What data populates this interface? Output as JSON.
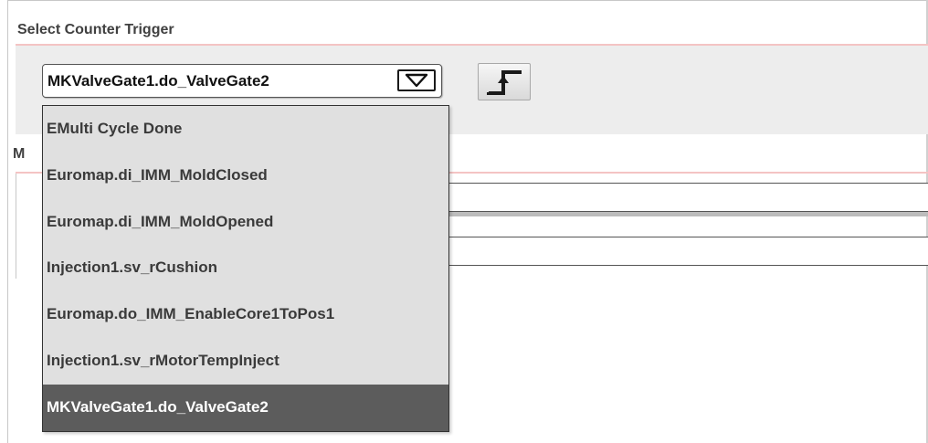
{
  "trigger_section": {
    "title": "Select Counter Trigger"
  },
  "combo": {
    "selected_value": "MKValveGate1.do_ValveGate2",
    "arrow_icon": "triangle-down-icon"
  },
  "edge_button": {
    "icon": "rising-edge-icon"
  },
  "second_section": {
    "title_partial": "M"
  },
  "dropdown": {
    "options": [
      "EMulti Cycle Done",
      "Euromap.di_IMM_MoldClosed",
      "Euromap.di_IMM_MoldOpened",
      "Injection1.sv_rCushion",
      "Euromap.do_IMM_EnableCore1ToPos1",
      "Injection1.sv_rMotorTempInject",
      "MKValveGate1.do_ValveGate2"
    ],
    "selected_index": 6
  },
  "colors": {
    "section_line": "#f4c4c4",
    "panel": "#ededed",
    "dropdown_bg": "#e0e0e0",
    "selected_bg": "#5c5c5c"
  }
}
